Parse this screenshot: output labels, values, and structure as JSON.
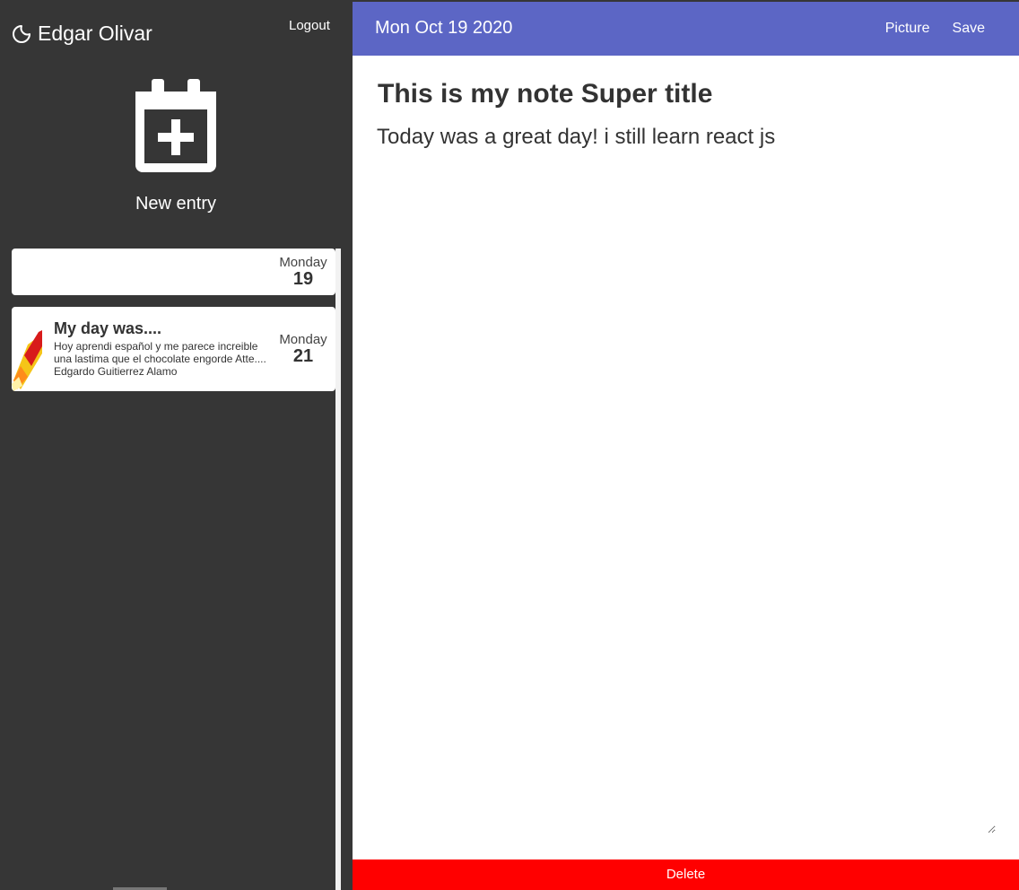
{
  "sidebar": {
    "user_name": "Edgar Olivar",
    "logout_label": "Logout",
    "new_entry_label": "New entry",
    "entries": [
      {
        "title": "",
        "text": "",
        "day_name": "Monday",
        "day_number": "19"
      },
      {
        "title": "My day was....",
        "text": "Hoy aprendi español y me parece increible una lastima que el chocolate engorde Atte.... Edgardo Guitierrez Alamo",
        "day_name": "Monday",
        "day_number": "21",
        "thumb_icon": "rocket-icon"
      }
    ]
  },
  "topbar": {
    "date": "Mon Oct 19 2020",
    "picture_label": "Picture",
    "save_label": "Save"
  },
  "note": {
    "title": "This is my note Super title",
    "body": "Today was a great day! i still learn react js"
  },
  "delete_label": "Delete",
  "colors": {
    "sidebar_bg": "#363636",
    "topbar_bg": "#5c66c5",
    "delete_bg": "#ff0000"
  }
}
